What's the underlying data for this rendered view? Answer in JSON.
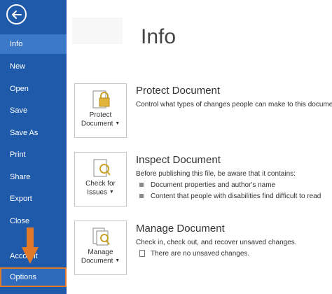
{
  "sidebar": {
    "back_label": "Back",
    "items": [
      {
        "label": "Info",
        "active": true
      },
      {
        "label": "New"
      },
      {
        "label": "Open"
      },
      {
        "label": "Save"
      },
      {
        "label": "Save As"
      },
      {
        "label": "Print"
      },
      {
        "label": "Share"
      },
      {
        "label": "Export"
      },
      {
        "label": "Close"
      },
      {
        "label": "Account"
      },
      {
        "label": "Options"
      }
    ]
  },
  "page": {
    "title": "Info"
  },
  "protect": {
    "tile_line1": "Protect",
    "tile_line2": "Document",
    "title": "Protect Document",
    "desc": "Control what types of changes people can make to this document."
  },
  "inspect": {
    "tile_line1": "Check for",
    "tile_line2": "Issues",
    "title": "Inspect Document",
    "desc": "Before publishing this file, be aware that it contains:",
    "bullets": [
      "Document properties and author's name",
      "Content that people with disabilities find difficult to read"
    ]
  },
  "manage": {
    "tile_line1": "Manage",
    "tile_line2": "Document",
    "title": "Manage Document",
    "desc": "Check in, check out, and recover unsaved changes.",
    "note": "There are no unsaved changes."
  },
  "colors": {
    "sidebar": "#1e5aa9",
    "highlight": "#e07a2a"
  }
}
